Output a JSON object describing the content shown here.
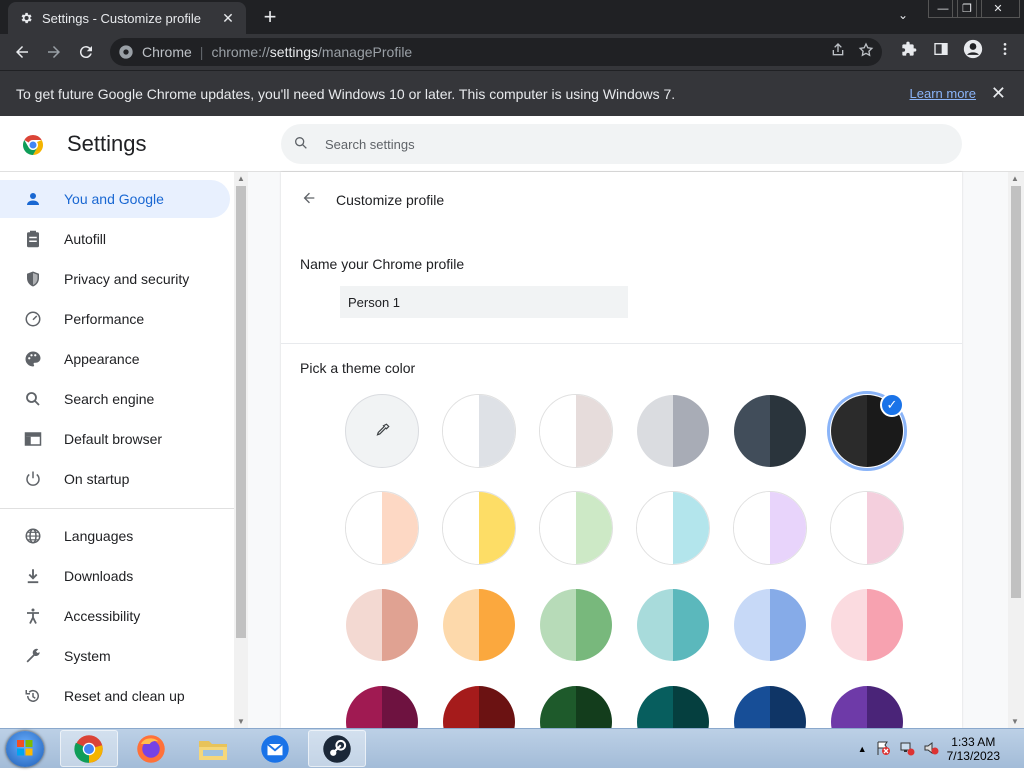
{
  "tab": {
    "title": "Settings - Customize profile",
    "close": "✕",
    "new_tab": "+"
  },
  "window_controls": {
    "minimize": "—",
    "restore": "❐",
    "close": "✕",
    "tab_search": "⌄"
  },
  "address_bar": {
    "site_label": "Chrome",
    "url_prefix": "chrome://",
    "url_bold": "settings",
    "url_suffix": "/manageProfile"
  },
  "infobar": {
    "message": "To get future Google Chrome updates, you'll need Windows 10 or later. This computer is using Windows 7.",
    "link": "Learn more",
    "close": "✕"
  },
  "settings": {
    "title": "Settings",
    "search_placeholder": "Search settings"
  },
  "sidebar": {
    "items": [
      {
        "label": "You and Google",
        "icon": "person-icon",
        "active": true
      },
      {
        "label": "Autofill",
        "icon": "clipboard-icon"
      },
      {
        "label": "Privacy and security",
        "icon": "shield-icon"
      },
      {
        "label": "Performance",
        "icon": "speedometer-icon"
      },
      {
        "label": "Appearance",
        "icon": "palette-icon"
      },
      {
        "label": "Search engine",
        "icon": "search-icon"
      },
      {
        "label": "Default browser",
        "icon": "browser-icon"
      },
      {
        "label": "On startup",
        "icon": "power-icon"
      },
      {
        "label": "Languages",
        "icon": "globe-icon"
      },
      {
        "label": "Downloads",
        "icon": "download-icon"
      },
      {
        "label": "Accessibility",
        "icon": "accessibility-icon"
      },
      {
        "label": "System",
        "icon": "wrench-icon"
      },
      {
        "label": "Reset and clean up",
        "icon": "history-icon"
      }
    ]
  },
  "profile": {
    "page_title": "Customize profile",
    "name_label": "Name your Chrome profile",
    "name_value": "Person 1",
    "theme_label": "Pick a theme color"
  },
  "themes": {
    "selected_index": 5,
    "colors": [
      [
        "#ffffff",
        "#ffffff"
      ],
      [
        "#ffffff",
        "#dee1e6"
      ],
      [
        "#ffffff",
        "#e6dcdb"
      ],
      [
        "#dadce0",
        "#a8acb6"
      ],
      [
        "#414d5a",
        "#2a343c"
      ],
      [
        "#2b2b2b",
        "#1a1a1a"
      ],
      [
        "#ffffff",
        "#fdd8c4"
      ],
      [
        "#ffffff",
        "#fddd66"
      ],
      [
        "#ffffff",
        "#cde9c6"
      ],
      [
        "#ffffff",
        "#b3e5ec"
      ],
      [
        "#ffffff",
        "#e8d4fb"
      ],
      [
        "#ffffff",
        "#f4cfdd"
      ],
      [
        "#f3d9d2",
        "#e0a292"
      ],
      [
        "#fdd9ab",
        "#fba83e"
      ],
      [
        "#b7dbb8",
        "#78b87c"
      ],
      [
        "#a8dbdb",
        "#5bb8bc"
      ],
      [
        "#c7d9f7",
        "#86abe8"
      ],
      [
        "#fbdbe0",
        "#f7a2b0"
      ],
      [
        "#a01a52",
        "#6e1240"
      ],
      [
        "#a51b1b",
        "#6b1212"
      ],
      [
        "#1e5a2b",
        "#133d1c"
      ],
      [
        "#075e5e",
        "#053f3f"
      ],
      [
        "#174e97",
        "#0f3566"
      ],
      [
        "#6e3aa8",
        "#4a2478"
      ]
    ]
  },
  "taskbar": {
    "apps": [
      "chrome-icon",
      "firefox-icon",
      "file-explorer-icon",
      "thunderbird-icon",
      "steam-icon"
    ],
    "time": "1:33 AM",
    "date": "7/13/2023"
  }
}
